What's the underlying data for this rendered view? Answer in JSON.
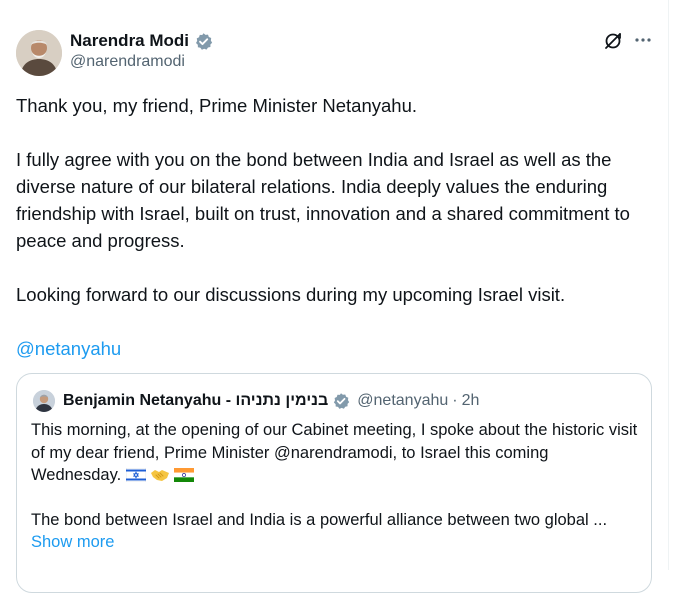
{
  "author": {
    "name": "Narendra Modi",
    "handle": "@narendramodi"
  },
  "tweet": {
    "line1": "Thank you, my friend, Prime Minister Netanyahu.",
    "line2": "I fully agree with you on the bond between India and Israel as well as the diverse nature of our bilateral relations. India deeply values the enduring friendship with Israel, built on trust, innovation and a shared commitment to peace and progress.",
    "line3": "Looking forward to our discussions during my upcoming Israel visit.",
    "mention": "@netanyahu"
  },
  "quoted": {
    "name": "Benjamin Netanyahu - בנימין נתניהו",
    "handle": "@netanyahu",
    "separator": "·",
    "time": "2h",
    "para1": "This morning, at the opening of our Cabinet meeting, I spoke about the historic visit of my dear friend, Prime Minister @narendramodi, to Israel this coming Wednesday.",
    "emojis": [
      "israel-flag",
      "handshake",
      "india-flag"
    ],
    "para2": "The bond between Israel and India is a powerful alliance between two global ...",
    "show_more": "Show more"
  },
  "icons": {
    "verified": "verified-badge-icon",
    "grok": "grok-icon",
    "more": "more-icon"
  },
  "colors": {
    "link": "#1d9bf0",
    "secondary_text": "#536471",
    "text": "#0f1419",
    "border": "#cfd9de"
  }
}
